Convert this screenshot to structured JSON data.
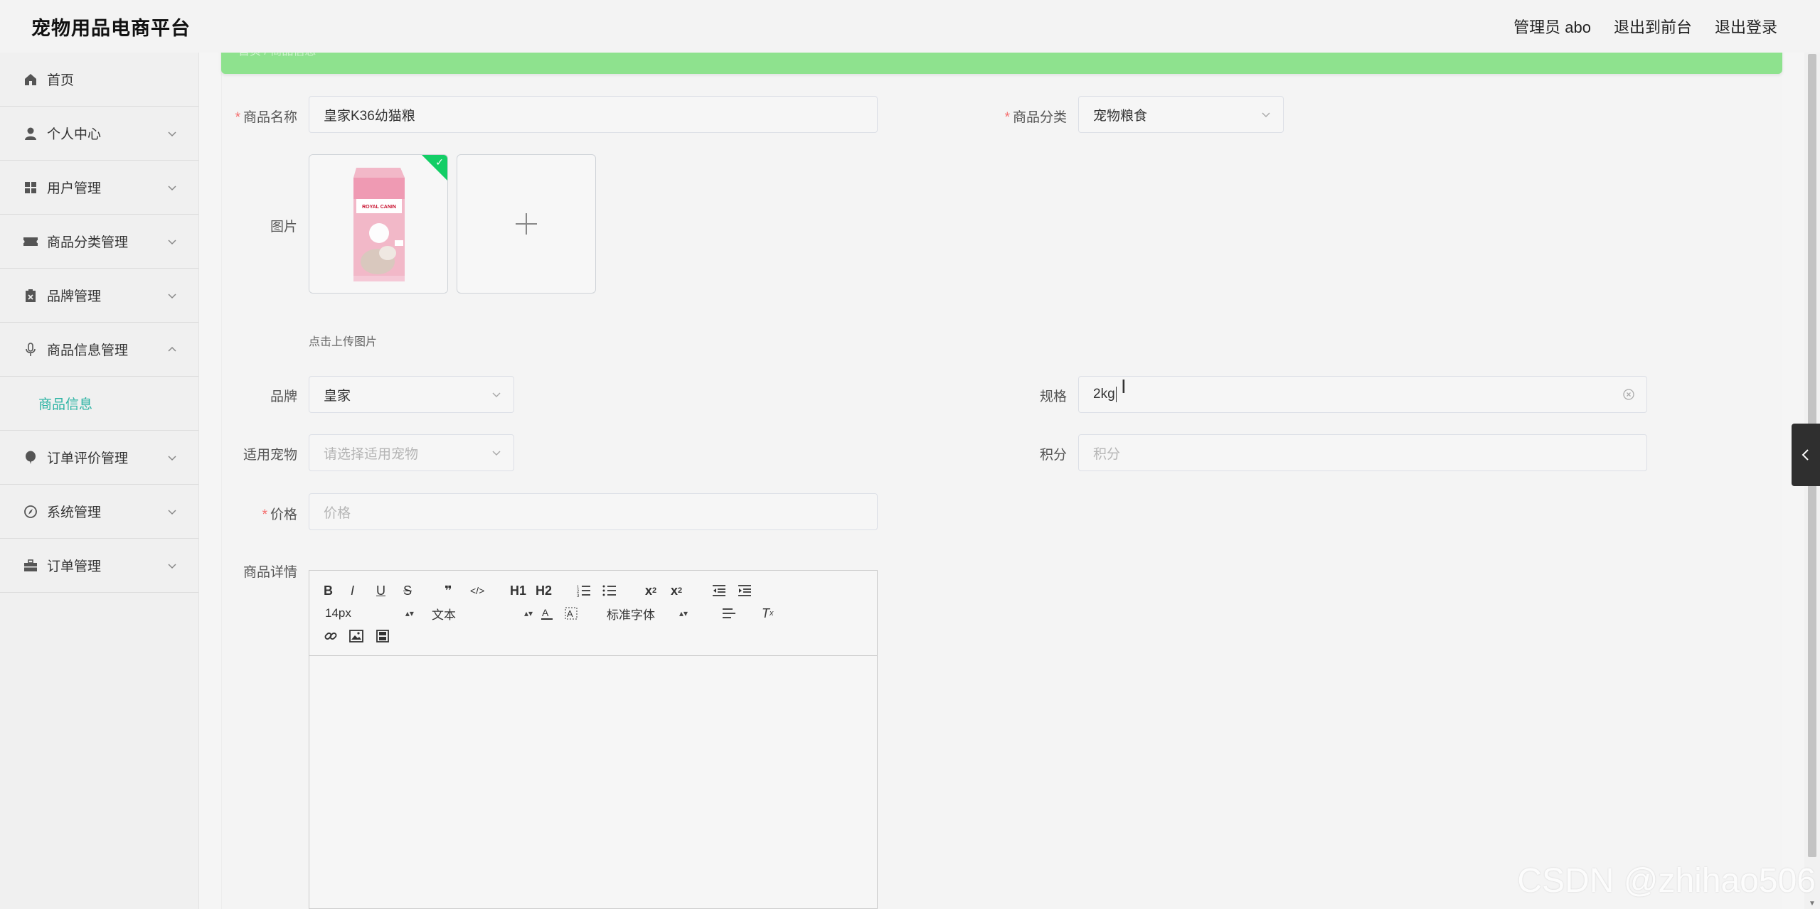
{
  "app": {
    "title": "宠物用品电商平台",
    "user_label": "管理员 abo",
    "to_front": "退出到前台",
    "logout": "退出登录"
  },
  "sidebar": {
    "items": [
      {
        "label": "首页",
        "icon": "home-icon"
      },
      {
        "label": "个人中心",
        "icon": "user-icon"
      },
      {
        "label": "用户管理",
        "icon": "grid-icon"
      },
      {
        "label": "商品分类管理",
        "icon": "ticket-icon"
      },
      {
        "label": "品牌管理",
        "icon": "clipboard-icon"
      },
      {
        "label": "商品信息管理",
        "icon": "microphone-icon"
      },
      {
        "label": "订单评价管理",
        "icon": "balloon-icon"
      },
      {
        "label": "系统管理",
        "icon": "compass-icon"
      },
      {
        "label": "订单管理",
        "icon": "briefcase-icon"
      }
    ],
    "active_sub": "商品信息",
    "accent_color": "#2bb3a3"
  },
  "breadcrumb": {
    "home": "首页",
    "current": "商品信息"
  },
  "form": {
    "name": {
      "label": "商品名称",
      "value": "皇家K36幼猫粮"
    },
    "category": {
      "label": "商品分类",
      "value": "宠物粮食"
    },
    "image": {
      "label": "图片",
      "tip": "点击上传图片"
    },
    "brand": {
      "label": "品牌",
      "value": "皇家"
    },
    "spec": {
      "label": "规格",
      "value": "2kg"
    },
    "pet": {
      "label": "适用宠物",
      "placeholder": "请选择适用宠物"
    },
    "points": {
      "label": "积分",
      "placeholder": "积分"
    },
    "price": {
      "label": "价格",
      "placeholder": "价格"
    },
    "detail": {
      "label": "商品详情"
    }
  },
  "editor": {
    "font_size": "14px",
    "header_select": "文本",
    "font_family": "标准字体",
    "h1": "H1",
    "h2": "H2"
  },
  "package": {
    "brand_text": "ROYAL CANIN"
  },
  "watermark": "CSDN @zhihao506"
}
